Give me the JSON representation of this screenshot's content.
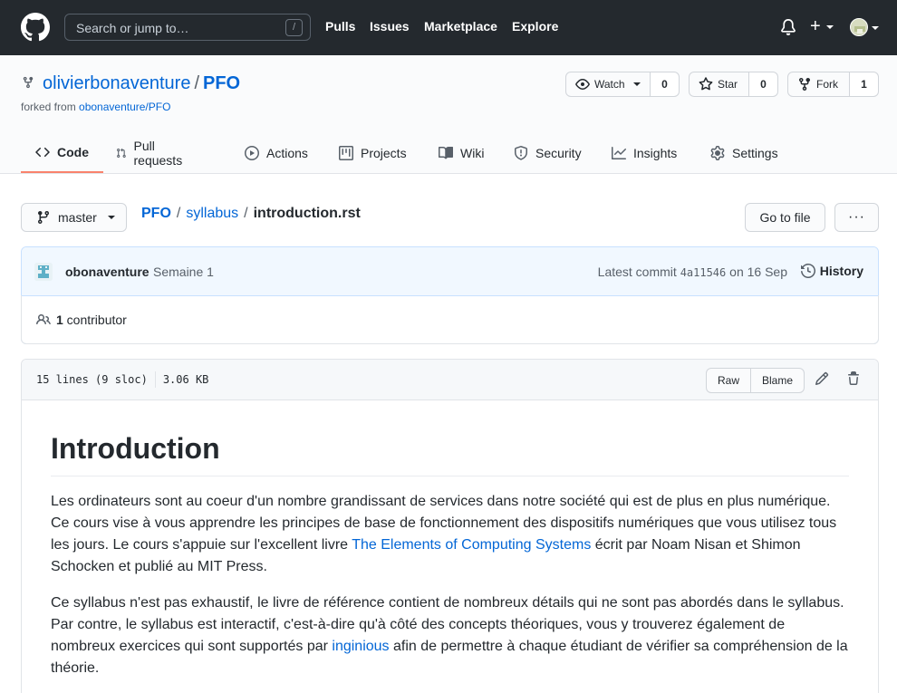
{
  "header": {
    "search_placeholder": "Search or jump to…",
    "search_shortcut": "/",
    "nav": [
      "Pulls",
      "Issues",
      "Marketplace",
      "Explore"
    ],
    "plus": "+"
  },
  "repo": {
    "owner": "olivierbonaventure",
    "separator": "/",
    "name": "PFO",
    "forked_prefix": "forked from ",
    "forked_from": "obonaventure/PFO",
    "watch_label": "Watch",
    "watch_count": "0",
    "star_label": "Star",
    "star_count": "0",
    "fork_label": "Fork",
    "fork_count": "1"
  },
  "tabs": [
    {
      "label": "Code",
      "icon": "code-icon"
    },
    {
      "label": "Pull requests",
      "icon": "pull-request-icon"
    },
    {
      "label": "Actions",
      "icon": "play-icon"
    },
    {
      "label": "Projects",
      "icon": "project-icon"
    },
    {
      "label": "Wiki",
      "icon": "book-icon"
    },
    {
      "label": "Security",
      "icon": "shield-icon"
    },
    {
      "label": "Insights",
      "icon": "graph-icon"
    },
    {
      "label": "Settings",
      "icon": "gear-icon"
    }
  ],
  "file_nav": {
    "branch": "master",
    "path": [
      "PFO",
      "syllabus"
    ],
    "sep": "/",
    "file": "introduction.rst",
    "goto_label": "Go to file",
    "more_label": "···"
  },
  "commit": {
    "author": "obonaventure",
    "message": "Semaine 1",
    "latest_prefix": "Latest commit",
    "sha": "4a11546",
    "date_text": "on 16 Sep",
    "history_label": "History",
    "contributors_count": "1",
    "contributors_label": " contributor"
  },
  "file": {
    "lines": "15 lines (9 sloc)",
    "size": "3.06 KB",
    "raw_label": "Raw",
    "blame_label": "Blame"
  },
  "article": {
    "title": "Introduction",
    "p1_before": "Les ordinateurs sont au coeur d'un nombre grandissant de services dans notre société qui est de plus en plus numérique. Ce cours vise à vous apprendre les principes de base de fonctionnement des dispositifs numériques que vous utilisez tous les jours. Le cours s'appuie sur l'excellent livre ",
    "p1_link": "The Elements of Computing Systems",
    "p1_after": " écrit par Noam Nisan et Shimon Schocken et publié au MIT Press.",
    "p2_before": "Ce syllabus n'est pas exhaustif, le livre de référence contient de nombreux détails qui ne sont pas abordés dans le syllabus. Par contre, le syllabus est interactif, c'est-à-dire qu'à côté des concepts théoriques, vous y trouverez également de nombreux exercices qui sont supportés par ",
    "p2_link": "inginious",
    "p2_after": " afin de permettre à chaque étudiant de vérifier sa compréhension de la théorie."
  }
}
